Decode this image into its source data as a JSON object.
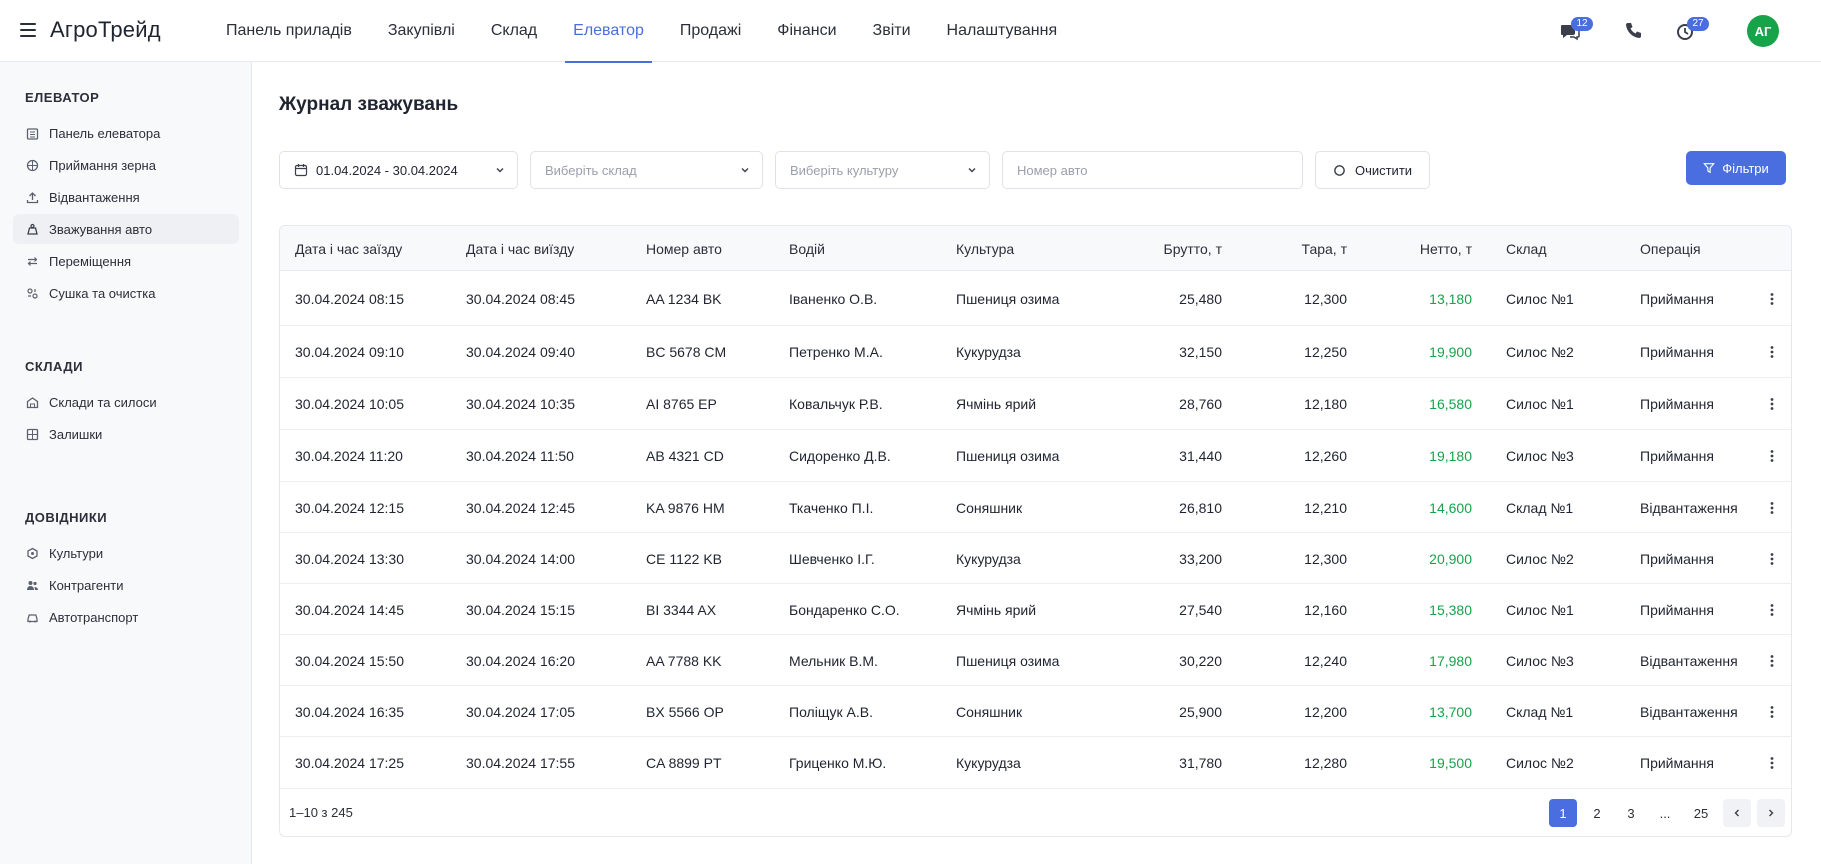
{
  "header": {
    "brand": "АгроТрейд",
    "nav": [
      "Панель приладів",
      "Закупівлі",
      "Склад",
      "Елеватор",
      "Продажі",
      "Фінанси",
      "Звіти",
      "Налаштування"
    ],
    "active_nav": "Елеватор",
    "messages_badge": "12",
    "notifications_badge": "27",
    "avatar": "АГ"
  },
  "sidebar": {
    "sections": [
      {
        "title": "ЕЛЕВАТОР",
        "items": [
          "Панель елеватора",
          "Приймання зерна",
          "Відвантаження",
          "Зважування авто",
          "Переміщення",
          "Сушка та очистка"
        ]
      },
      {
        "title": "СКЛАДИ",
        "items": [
          "Склади та силоси",
          "Залишки"
        ]
      },
      {
        "title": "ДОВІДНИКИ",
        "items": [
          "Культури",
          "Контрагенти",
          "Автотранспорт"
        ]
      }
    ],
    "active_item": "Зважування авто"
  },
  "main": {
    "title": "Журнал зважувань",
    "filters": {
      "date_range": "01.04.2024 - 30.04.2024",
      "warehouse_placeholder": "Виберіть склад",
      "crop_placeholder": "Виберіть культуру",
      "plate_placeholder": "Номер авто",
      "clear_label": "Очистити",
      "filters_label": "Фільтри"
    },
    "table": {
      "columns": [
        "Дата і час заїзду",
        "Дата і час виїзду",
        "Номер авто",
        "Водій",
        "Культура",
        "Брутто, т",
        "Тара, т",
        "Нетто, т",
        "Склад",
        "Операція"
      ],
      "rows": [
        [
          "30.04.2024 08:15",
          "30.04.2024 08:45",
          "AA 1234 BK",
          "Іваненко О.В.",
          "Пшениця озима",
          "25,480",
          "12,300",
          "13,180",
          "Силос №1",
          "Приймання"
        ],
        [
          "30.04.2024 09:10",
          "30.04.2024 09:40",
          "BC 5678 CM",
          "Петренко М.А.",
          "Кукурудза",
          "32,150",
          "12,250",
          "19,900",
          "Силос №2",
          "Приймання"
        ],
        [
          "30.04.2024 10:05",
          "30.04.2024 10:35",
          "AI 8765 EP",
          "Ковальчук Р.В.",
          "Ячмінь ярий",
          "28,760",
          "12,180",
          "16,580",
          "Силос №1",
          "Приймання"
        ],
        [
          "30.04.2024 11:20",
          "30.04.2024 11:50",
          "AB 4321 CD",
          "Сидоренко Д.В.",
          "Пшениця озима",
          "31,440",
          "12,260",
          "19,180",
          "Силос №3",
          "Приймання"
        ],
        [
          "30.04.2024 12:15",
          "30.04.2024 12:45",
          "KA 9876 HM",
          "Ткаченко П.І.",
          "Соняшник",
          "26,810",
          "12,210",
          "14,600",
          "Склад №1",
          "Відвантаження"
        ],
        [
          "30.04.2024 13:30",
          "30.04.2024 14:00",
          "CE 1122 KB",
          "Шевченко І.Г.",
          "Кукурудза",
          "33,200",
          "12,300",
          "20,900",
          "Силос №2",
          "Приймання"
        ],
        [
          "30.04.2024 14:45",
          "30.04.2024 15:15",
          "BI 3344 AX",
          "Бондаренко С.О.",
          "Ячмінь ярий",
          "27,540",
          "12,160",
          "15,380",
          "Силос №1",
          "Приймання"
        ],
        [
          "30.04.2024 15:50",
          "30.04.2024 16:20",
          "AA 7788 KK",
          "Мельник В.М.",
          "Пшениця озима",
          "30,220",
          "12,240",
          "17,980",
          "Силос №3",
          "Відвантаження"
        ],
        [
          "30.04.2024 16:35",
          "30.04.2024 17:05",
          "BX 5566 OP",
          "Поліщук А.В.",
          "Соняшник",
          "25,900",
          "12,200",
          "13,700",
          "Склад №1",
          "Відвантаження"
        ],
        [
          "30.04.2024 17:25",
          "30.04.2024 17:55",
          "CA 8899 PT",
          "Гриценко М.Ю.",
          "Кукурудза",
          "31,780",
          "12,280",
          "19,500",
          "Силос №2",
          "Приймання"
        ]
      ],
      "count_label": "1–10 з 245",
      "pages": [
        "1",
        "2",
        "3",
        "...",
        "25"
      ],
      "active_page": "1"
    }
  },
  "colors": {
    "accent": "#4a6ee0",
    "positive": "#16a34a",
    "avatar": "#16a34a"
  }
}
